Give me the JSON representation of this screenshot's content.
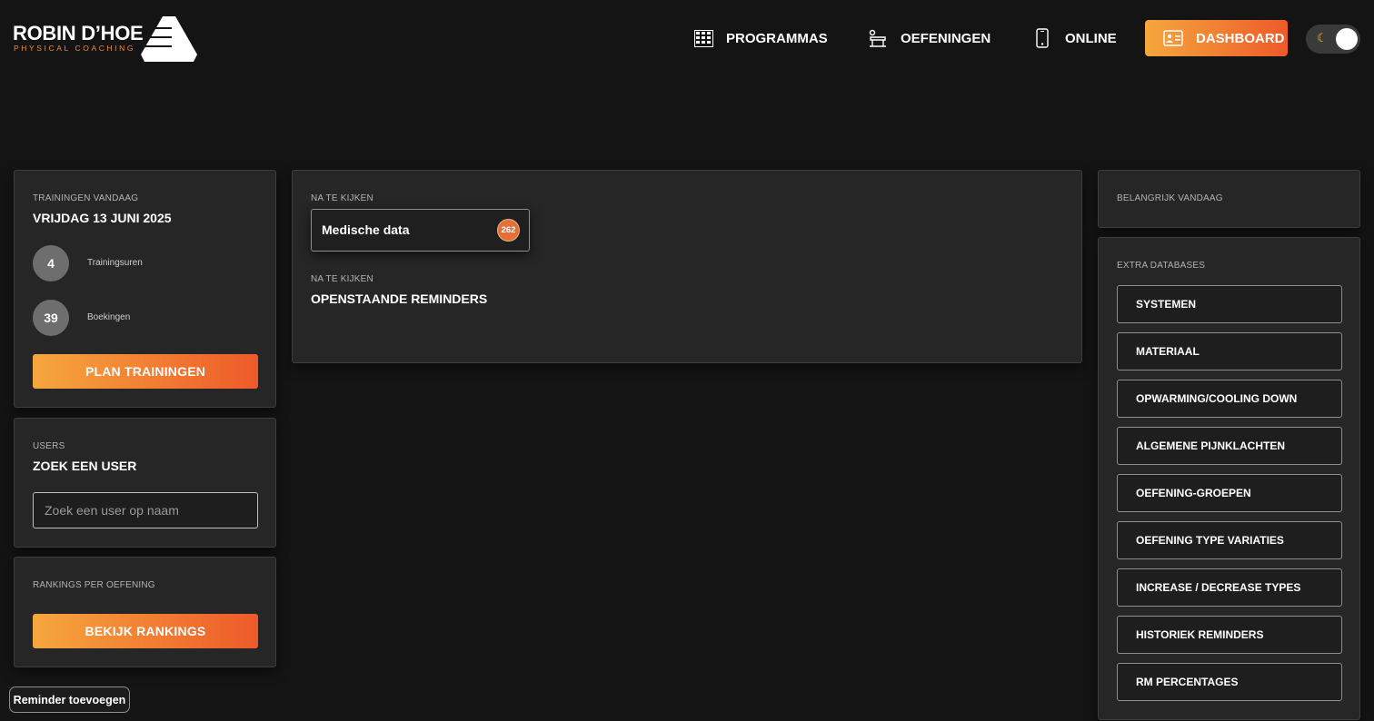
{
  "logo": {
    "main": "ROBIN D’HOE",
    "sub": "PHYSICAL COACHING"
  },
  "nav": {
    "programmas": {
      "label": "PROGRAMMAS",
      "icon": "calendar-grid-icon"
    },
    "oefeningen": {
      "label": "OEFENINGEN",
      "icon": "bench-icon"
    },
    "online": {
      "label": "ONLINE",
      "icon": "phone-icon"
    },
    "dashboard": {
      "label": "DASHBOARD",
      "icon": "id-card-icon"
    }
  },
  "theme_toggle": {
    "icon": "moon-icon",
    "state": "dark"
  },
  "colors": {
    "accent_start": "#f5a73d",
    "accent_end": "#ee5a2a",
    "background": "#141414",
    "card": "#262626"
  },
  "trainingen": {
    "eyebrow": "TRAININGEN VANDAAG",
    "date": "VRIJDAG 13 JUNI 2025",
    "stats": [
      {
        "value": "4",
        "label": "Trainingsuren"
      },
      {
        "value": "39",
        "label": "Boekingen"
      }
    ],
    "button": "PLAN TRAININGEN"
  },
  "users": {
    "eyebrow": "USERS",
    "title": "ZOEK EEN USER",
    "search_placeholder": "Zoek een user op naam",
    "search_value": ""
  },
  "rankings": {
    "eyebrow": "RANKINGS PER OEFENING",
    "button": "BEKIJK RANKINGS"
  },
  "review": {
    "eyebrow1": "NA TE KIJKEN",
    "medical": {
      "label": "Medische data",
      "count": "262"
    },
    "eyebrow2": "NA TE KIJKEN",
    "reminders_title": "OPENSTAANDE REMINDERS"
  },
  "belangrijk": {
    "eyebrow": "BELANGRIJK VANDAAG"
  },
  "extra": {
    "eyebrow": "EXTRA DATABASES",
    "items": [
      "SYSTEMEN",
      "MATERIAAL",
      "OPWARMING/COOLING DOWN",
      "ALGEMENE PIJNKLACHTEN",
      "OEFENING-GROEPEN",
      "OEFENING TYPE VARIATIES",
      "INCREASE / DECREASE TYPES",
      "HISTORIEK REMINDERS",
      "RM PERCENTAGES"
    ]
  },
  "reminder_button": "Reminder toevoegen"
}
